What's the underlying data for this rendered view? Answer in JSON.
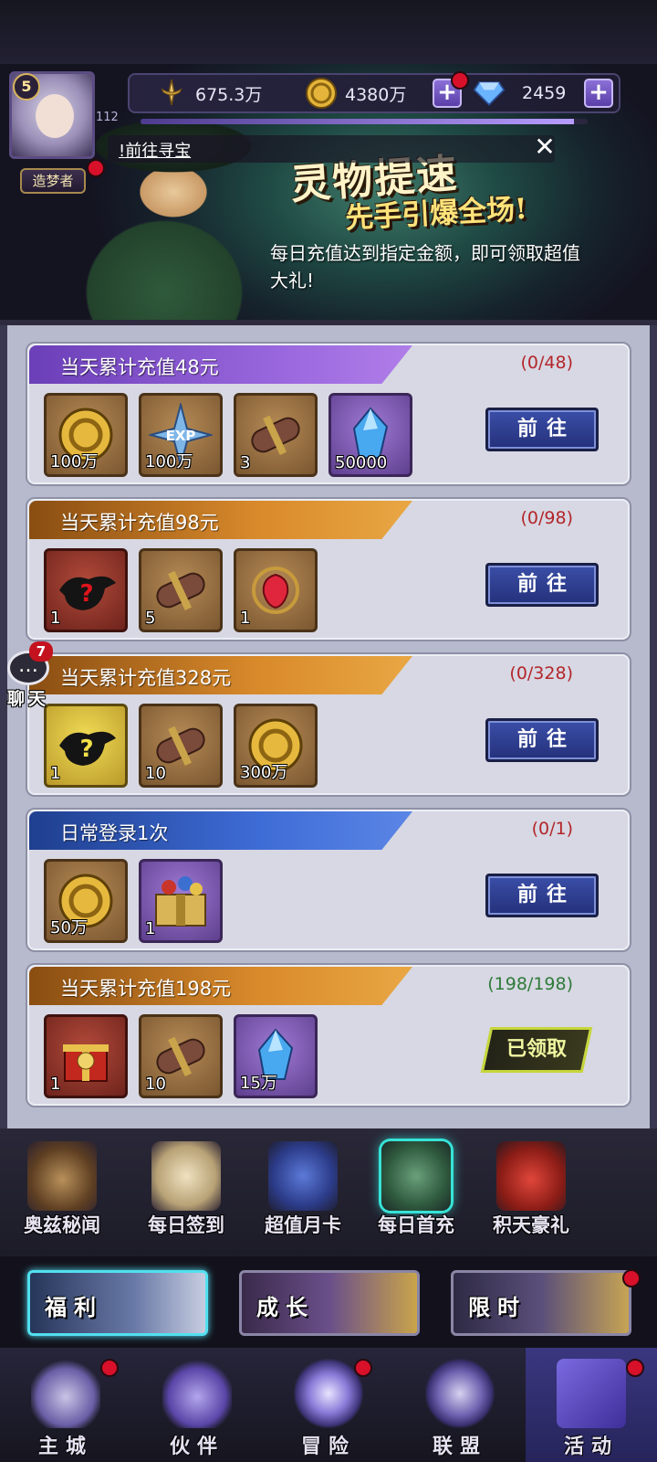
{
  "header": {
    "player_level": "5",
    "vip_level": "112",
    "player_title": "造梦者",
    "xp_fraction": 0.97,
    "resources": [
      {
        "name": "power",
        "icon": "sword-icon",
        "value": "675.3万"
      },
      {
        "name": "gold",
        "icon": "gold-coin-icon",
        "value": "4380万"
      },
      {
        "name": "diamond",
        "icon": "diamond-icon",
        "value": "2459"
      }
    ],
    "plus_label": "+",
    "ticker_text": "!前往寻宝",
    "close_label": "✕"
  },
  "banner": {
    "title": "灵物提速",
    "subtitle": "先手引爆全场!",
    "description": "每日充值达到指定金额，即可领取超值大礼!"
  },
  "tasks": [
    {
      "title": "当天累计充值48元",
      "progress": "(0/48)",
      "status": "go",
      "header_color": "purple",
      "items": [
        {
          "icon": "gold-coin-icon",
          "quality": "brown",
          "qty": "100万"
        },
        {
          "icon": "exp-star-icon",
          "quality": "brown",
          "qty": "100万"
        },
        {
          "icon": "scroll-icon",
          "quality": "brown",
          "qty": "3"
        },
        {
          "icon": "crystal-icon",
          "quality": "purple",
          "qty": "50000"
        }
      ],
      "action_label": "前往"
    },
    {
      "title": "当天累计充值98元",
      "progress": "(0/98)",
      "status": "go",
      "header_color": "orange",
      "items": [
        {
          "icon": "mystery-lamp-icon",
          "quality": "red",
          "qty": "1"
        },
        {
          "icon": "scroll-icon",
          "quality": "brown",
          "qty": "5"
        },
        {
          "icon": "red-gem-icon",
          "quality": "brown",
          "qty": "1"
        }
      ],
      "action_label": "前往"
    },
    {
      "title": "当天累计充值328元",
      "progress": "(0/328)",
      "status": "go",
      "header_color": "orange",
      "items": [
        {
          "icon": "mystery-lamp-icon",
          "quality": "gold",
          "qty": "1"
        },
        {
          "icon": "scroll-icon",
          "quality": "brown",
          "qty": "10"
        },
        {
          "icon": "gold-coin-icon",
          "quality": "brown",
          "qty": "300万"
        }
      ],
      "action_label": "前往"
    },
    {
      "title": "日常登录1次",
      "progress": "(0/1)",
      "status": "go",
      "header_color": "blue",
      "items": [
        {
          "icon": "gold-coin-icon",
          "quality": "brown",
          "qty": "50万"
        },
        {
          "icon": "treasure-box-icon",
          "quality": "purple",
          "qty": "1"
        }
      ],
      "action_label": "前往"
    },
    {
      "title": "当天累计充值198元",
      "progress": "(198/198)",
      "status": "claimed",
      "header_color": "orange",
      "items": [
        {
          "icon": "gift-box-icon",
          "quality": "red",
          "qty": "1"
        },
        {
          "icon": "scroll-icon",
          "quality": "brown",
          "qty": "10"
        },
        {
          "icon": "crystal-icon",
          "quality": "purple",
          "qty": "15万"
        }
      ],
      "action_label": "已领取"
    }
  ],
  "chat": {
    "badge": "7",
    "label": "聊天"
  },
  "activity_tabs": [
    {
      "label": "奥兹秘闻",
      "icon": "scarecrow-icon",
      "active": false
    },
    {
      "label": "每日签到",
      "icon": "quill-scroll-icon",
      "active": false
    },
    {
      "label": "超值月卡",
      "icon": "month-card-icon",
      "active": false
    },
    {
      "label": "每日首充",
      "icon": "witch-icon",
      "active": true
    },
    {
      "label": "积天豪礼",
      "icon": "gift-box-icon",
      "active": false
    }
  ],
  "features": [
    {
      "label": "福利",
      "active": true,
      "badge": false
    },
    {
      "label": "成长",
      "active": false,
      "badge": false
    },
    {
      "label": "限时",
      "active": false,
      "badge": true
    }
  ],
  "nav": [
    {
      "label": "主城",
      "icon": "castle-icon",
      "badge": true,
      "active": false
    },
    {
      "label": "伙伴",
      "icon": "wizard-hat-icon",
      "badge": false,
      "active": false
    },
    {
      "label": "冒险",
      "icon": "compass-icon",
      "badge": true,
      "active": false
    },
    {
      "label": "联盟",
      "icon": "shield-icon",
      "badge": false,
      "active": false
    },
    {
      "label": "活动",
      "icon": "cards-icon",
      "badge": true,
      "active": true
    }
  ],
  "colors": {
    "accent_cyan": "#36e3d6",
    "progress_incomplete": "#b3262a",
    "progress_complete": "#2f7a3a",
    "go_button": "#2f3f94",
    "notification_red": "#d8102a"
  }
}
